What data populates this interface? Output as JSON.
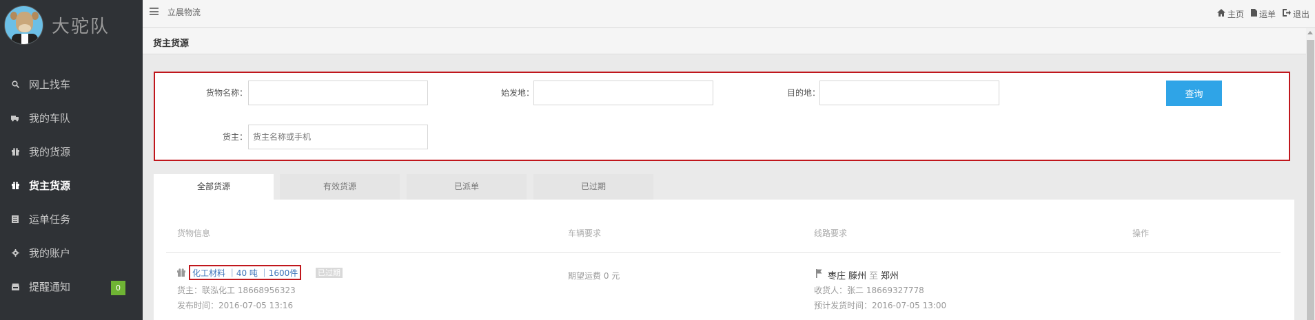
{
  "app": {
    "brand": "大驼队"
  },
  "sidebar": {
    "items": [
      {
        "label": "网上找车",
        "icon": "search-icon"
      },
      {
        "label": "我的车队",
        "icon": "truck-icon"
      },
      {
        "label": "我的货源",
        "icon": "gift-icon"
      },
      {
        "label": "货主货源",
        "icon": "gift-icon",
        "active": true
      },
      {
        "label": "运单任务",
        "icon": "list-icon"
      },
      {
        "label": "我的账户",
        "icon": "gear-icon"
      },
      {
        "label": "提醒通知",
        "icon": "inbox-icon",
        "badge": "0"
      }
    ]
  },
  "topbar": {
    "company": "立晨物流",
    "links": [
      {
        "label": "主页",
        "icon": "home-icon"
      },
      {
        "label": "运单",
        "icon": "file-icon"
      },
      {
        "label": "退出",
        "icon": "logout-icon"
      }
    ]
  },
  "page": {
    "title": "货主货源"
  },
  "search": {
    "cargo_name_label": "货物名称：",
    "cargo_name_value": "",
    "origin_label": "始发地：",
    "origin_value": "",
    "destination_label": "目的地：",
    "destination_value": "",
    "shipper_label": "货主：",
    "shipper_placeholder": "货主名称或手机",
    "query_button": "查询"
  },
  "tabs": [
    {
      "label": "全部货源",
      "active": true
    },
    {
      "label": "有效货源"
    },
    {
      "label": "已派单"
    },
    {
      "label": "已过期"
    }
  ],
  "table": {
    "headers": {
      "cargo_info": "货物信息",
      "vehicle_req": "车辆要求",
      "route_req": "线路要求",
      "actions": "操作"
    },
    "rows": [
      {
        "cargo_summary": "化工材料 ｜40 吨 ｜1600件",
        "status": "已过期",
        "shipper_label": "货主：",
        "shipper": "联泓化工 18668956323",
        "publish_label": "发布时间：",
        "publish_time": "2016-07-05 13:16",
        "freight_label": "期望运费",
        "freight": "0 元",
        "origin": "枣庄 滕州",
        "to_word": "至",
        "destination": "郑州",
        "consignee_label": "收货人：",
        "consignee": "张二 18669327778",
        "ship_time_label": "预计发货时间：",
        "ship_time": "2016-07-05 13:00"
      }
    ]
  },
  "colors": {
    "sidebar_bg": "#2f3236",
    "accent_blue": "#2fa4e7",
    "highlight_red": "#c0161c",
    "badge_green": "#6fb434",
    "link_blue": "#3b73b9"
  }
}
